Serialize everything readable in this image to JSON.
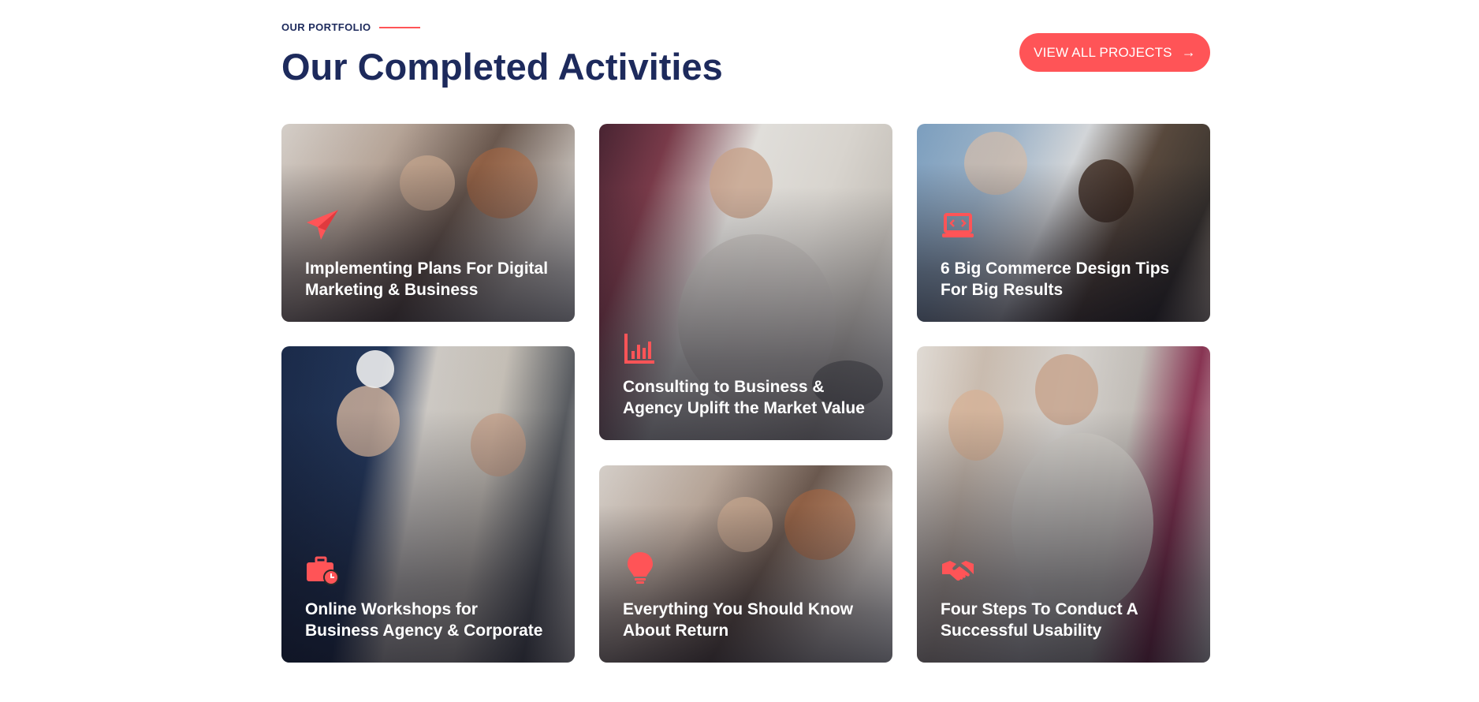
{
  "header": {
    "eyebrow": "OUR PORTFOLIO",
    "title": "Our Completed Activities",
    "cta_label": "VIEW ALL PROJECTS",
    "cta_arrow": "→"
  },
  "colors": {
    "accent": "#ff5457",
    "heading": "#1d2a5c",
    "white": "#ffffff"
  },
  "cards": [
    {
      "title": "Implementing Plans For Digital Marketing & Business",
      "icon": "paper-plane-icon"
    },
    {
      "title": "Consulting to Business & Agency Uplift the Market Value",
      "icon": "bar-chart-icon"
    },
    {
      "title": "6 Big Commerce Design Tips For Big Results",
      "icon": "laptop-code-icon"
    },
    {
      "title": "Online Workshops for Business Agency & Corporate",
      "icon": "briefcase-clock-icon"
    },
    {
      "title": "Everything You Should Know About Return",
      "icon": "lightbulb-icon"
    },
    {
      "title": "Four Steps To Conduct A Successful Usability",
      "icon": "handshake-icon"
    }
  ]
}
